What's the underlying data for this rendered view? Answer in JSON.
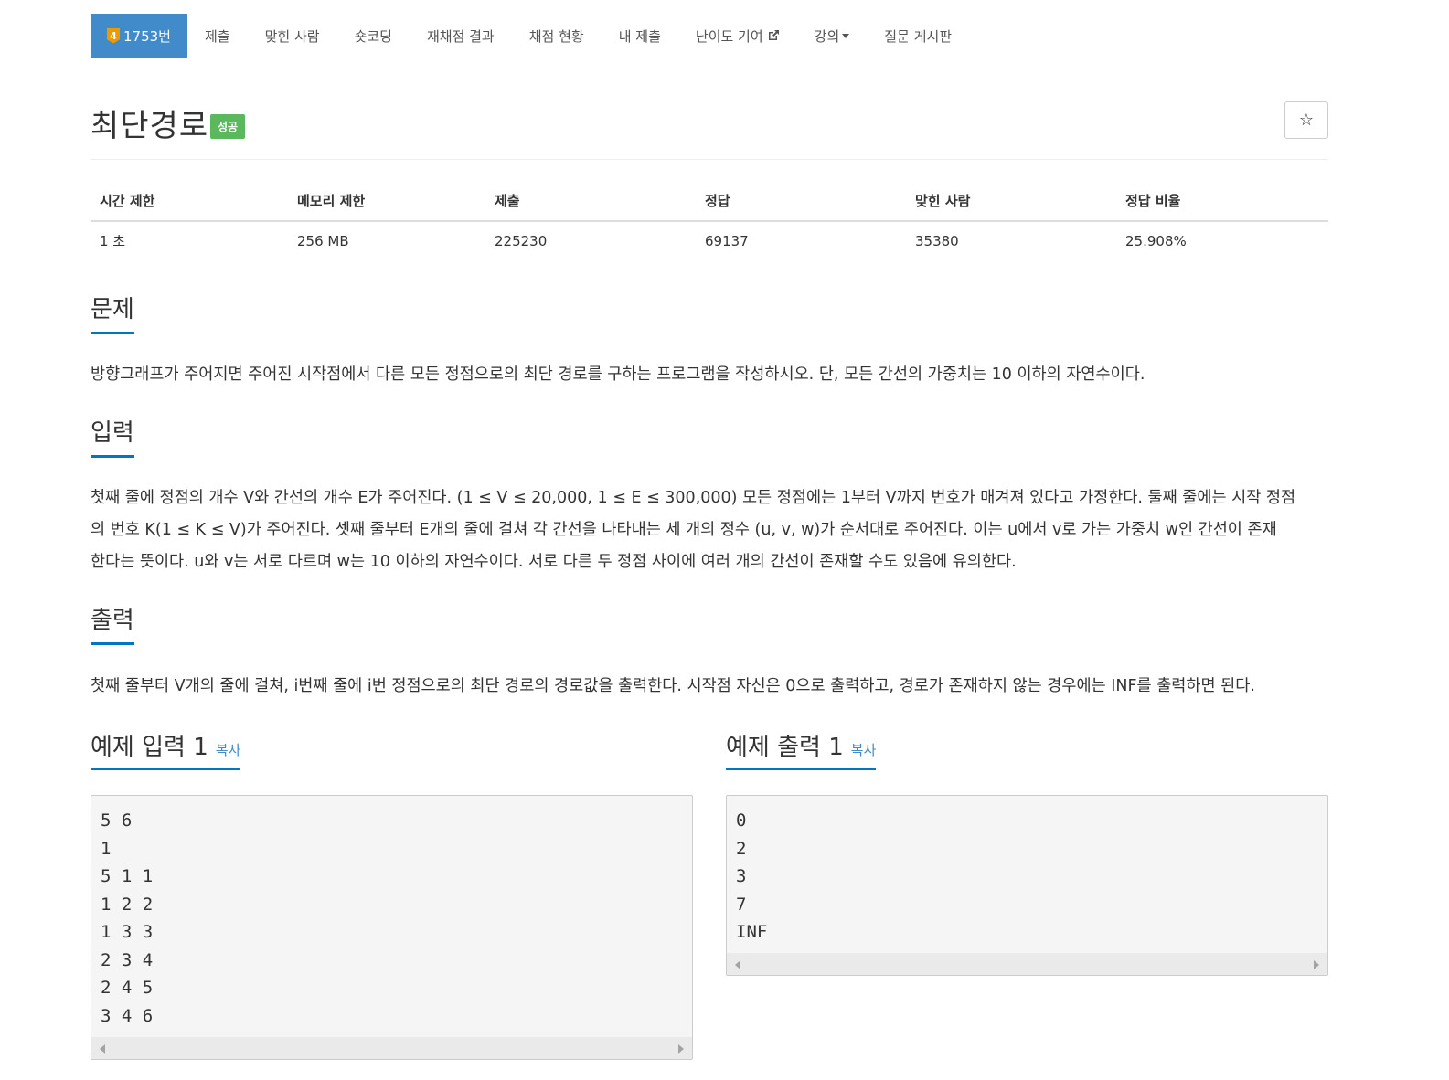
{
  "nav": {
    "tier": "4",
    "items": [
      "1753번",
      "제출",
      "맞힌 사람",
      "숏코딩",
      "재채점 결과",
      "채점 현황",
      "내 제출",
      "난이도 기여",
      "강의",
      "질문 게시판"
    ]
  },
  "problem": {
    "title": "최단경로",
    "status": "성공",
    "star_icon": "☆"
  },
  "info": {
    "headers": [
      "시간 제한",
      "메모리 제한",
      "제출",
      "정답",
      "맞힌 사람",
      "정답 비율"
    ],
    "values": [
      "1 초",
      "256 MB",
      "225230",
      "69137",
      "35380",
      "25.908%"
    ]
  },
  "sections": {
    "description": {
      "heading": "문제",
      "text": "방향그래프가 주어지면 주어진 시작점에서 다른 모든 정점으로의 최단 경로를 구하는 프로그램을 작성하시오. 단, 모든 간선의 가중치는 10 이하의 자연수이다."
    },
    "input": {
      "heading": "입력",
      "lines": [
        "첫째 줄에 정점의 개수 V와 간선의 개수 E가 주어진다. (1 ≤ V ≤ 20,000, 1 ≤ E ≤ 300,000) 모든 정점에는 1부터 V까지 번호가 매겨져 있다고 가정한다. 둘째 줄에는 시작 정점",
        "의 번호 K(1 ≤ K ≤ V)가 주어진다. 셋째 줄부터 E개의 줄에 걸쳐 각 간선을 나타내는 세 개의 정수 (u, v, w)가 순서대로 주어진다. 이는 u에서 v로 가는 가중치 w인 간선이 존재",
        "한다는 뜻이다. u와 v는 서로 다르며 w는 10 이하의 자연수이다. 서로 다른 두 정점 사이에 여러 개의 간선이 존재할 수도 있음에 유의한다."
      ]
    },
    "output": {
      "heading": "출력",
      "text": "첫째 줄부터 V개의 줄에 걸쳐, i번째 줄에 i번 정점으로의 최단 경로의 경로값을 출력한다. 시작점 자신은 0으로 출력하고, 경로가 존재하지 않는 경우에는 INF를 출력하면 된다."
    }
  },
  "samples": {
    "input": {
      "heading": "예제 입력 1",
      "copy": "복사",
      "lines": [
        "5 6",
        "1",
        "5 1 1",
        "1 2 2",
        "1 3 3",
        "2 3 4",
        "2 4 5",
        "3 4 6"
      ]
    },
    "output": {
      "heading": "예제 출력 1",
      "copy": "복사",
      "lines": [
        "0",
        "2",
        "3",
        "7",
        "INF"
      ]
    }
  },
  "colors": {
    "accent": "#428bca",
    "tier_badge": "#ec9a00",
    "success": "#5cb85c",
    "section_underline": "#0076c0"
  }
}
